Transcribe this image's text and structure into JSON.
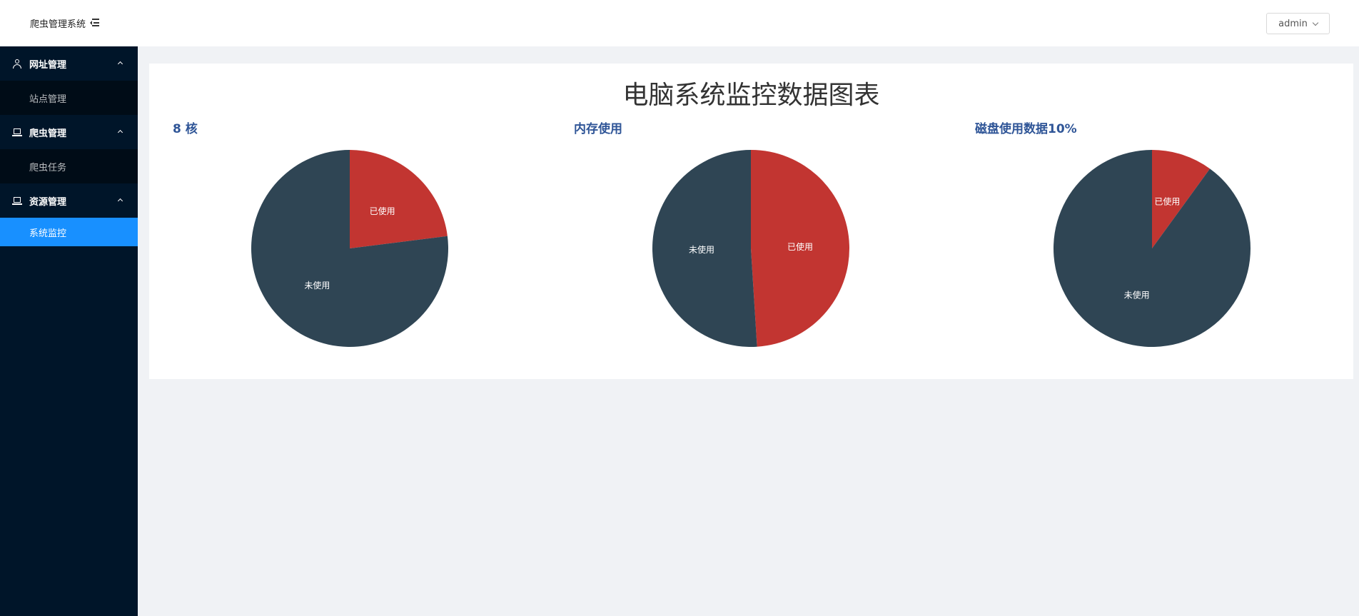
{
  "header": {
    "brand": "爬虫管理系统",
    "user": "admin"
  },
  "sidebar": {
    "groups": [
      {
        "title": "网址管理",
        "icon": "user-icon",
        "items": [
          {
            "label": "站点管理",
            "active": false
          }
        ]
      },
      {
        "title": "爬虫管理",
        "icon": "laptop-icon",
        "items": [
          {
            "label": "爬虫任务",
            "active": false
          }
        ]
      },
      {
        "title": "资源管理",
        "icon": "laptop-icon",
        "items": [
          {
            "label": "系统监控",
            "active": true
          }
        ]
      }
    ]
  },
  "page": {
    "title": "电脑系统监控数据图表"
  },
  "colors": {
    "used": "#c23531",
    "unused": "#2f4554",
    "active_menu": "#1890ff",
    "sidebar_bg": "#001529",
    "chart_title": "#2f5597"
  },
  "chart_data": [
    {
      "type": "pie",
      "title": "8 核",
      "slices": [
        {
          "name": "已使用",
          "value": 23
        },
        {
          "name": "未使用",
          "value": 77
        }
      ]
    },
    {
      "type": "pie",
      "title": "内存使用",
      "slices": [
        {
          "name": "已使用",
          "value": 49
        },
        {
          "name": "未使用",
          "value": 51
        }
      ]
    },
    {
      "type": "pie",
      "title": "磁盘使用数据10%",
      "slices": [
        {
          "name": "已使用",
          "value": 10
        },
        {
          "name": "未使用",
          "value": 90
        }
      ]
    }
  ]
}
